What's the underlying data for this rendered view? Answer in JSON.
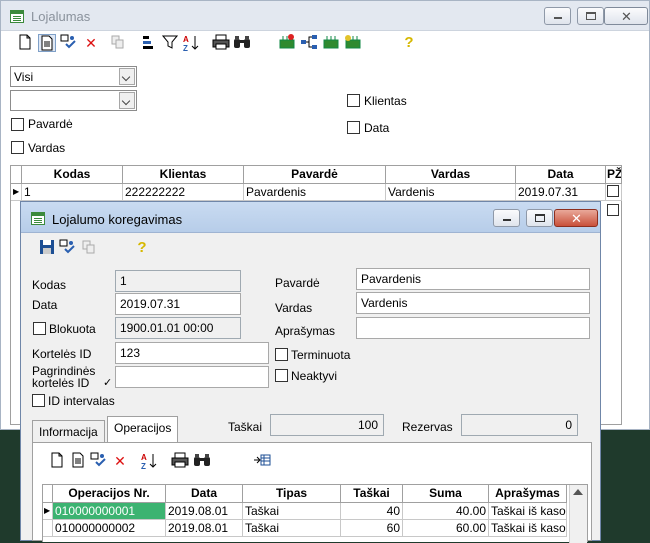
{
  "back_window": {
    "title": "Lojalumas",
    "filter": {
      "dropdown1_value": "Visi",
      "dropdown2_value": "",
      "checkboxes": {
        "pavarde": "Pavardė",
        "vardas": "Vardas",
        "klientas": "Klientas",
        "data": "Data"
      }
    },
    "grid": {
      "columns": [
        "Kodas",
        "Klientas",
        "Pavardė",
        "Vardas",
        "Data",
        "PŽ"
      ],
      "rows": [
        [
          "1",
          "222222222",
          "Pavardenis",
          "Vardenis",
          "2019.07.31",
          ""
        ]
      ]
    }
  },
  "edit_window": {
    "title": "Lojalumo koregavimas",
    "fields": {
      "kodas_label": "Kodas",
      "kodas_value": "1",
      "data_label": "Data",
      "data_value": "2019.07.31",
      "blokuota_label": "Blokuota",
      "blokuota_value": "1900.01.01 00:00",
      "kortele_label": "Kortelės ID",
      "kortele_value": "123",
      "pagrindines_label_1": "Pagrindinės",
      "pagrindines_label_2": "kortelės ID",
      "pagrindines_value": "",
      "id_intervalas_label": "ID intervalas",
      "pavarde_label": "Pavardė",
      "pavarde_value": "Pavardenis",
      "vardas_label": "Vardas",
      "vardas_value": "Vardenis",
      "aprasymas_label": "Aprašymas",
      "aprasymas_value": "",
      "terminuota_label": "Terminuota",
      "neaktyvi_label": "Neaktyvi"
    },
    "tabs": [
      "Informacija",
      "Operacijos"
    ],
    "taskai_label": "Taškai",
    "taskai_value": "100",
    "rezervas_label": "Rezervas",
    "rezervas_value": "0",
    "ops_grid": {
      "columns": [
        "Operacijos Nr.",
        "Data",
        "Tipas",
        "Taškai",
        "Suma",
        "Aprašymas"
      ],
      "rows": [
        [
          "010000000001",
          "2019.08.01",
          "Taškai",
          "40",
          "40.00",
          "Taškai iš kasos"
        ],
        [
          "010000000002",
          "2019.08.01",
          "Taškai",
          "60",
          "60.00",
          "Taškai iš kasos"
        ]
      ]
    }
  }
}
